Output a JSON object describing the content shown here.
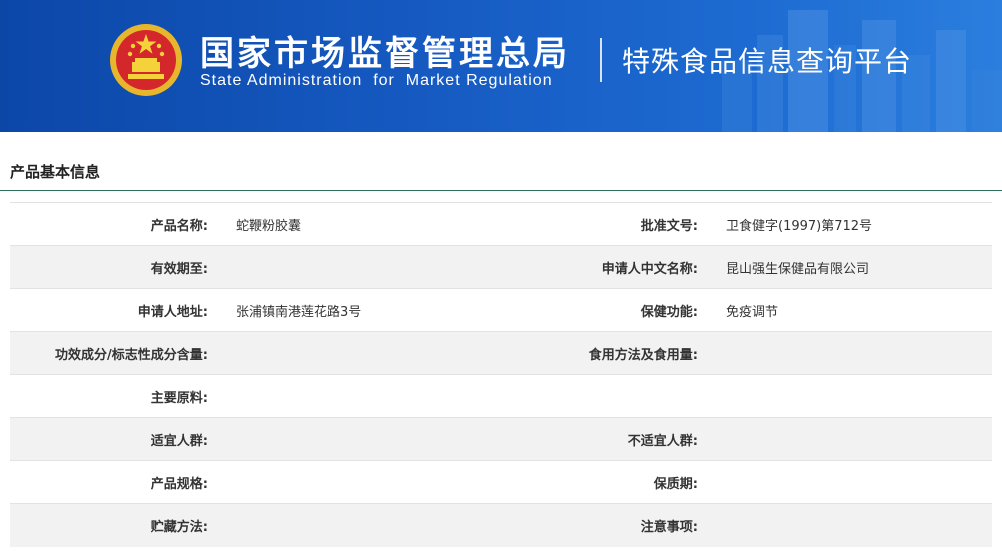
{
  "header": {
    "org_cn": "国家市场监督管理总局",
    "org_en": "State Administration  for  Market Regulation",
    "platform": "特殊食品信息查询平台",
    "brand_color": "#1559c0"
  },
  "panel": {
    "title": "产品基本信息"
  },
  "rows": [
    {
      "label1": "产品名称:",
      "value1": "蛇鞭粉胶囊",
      "label2": "批准文号:",
      "value2": "卫食健字(1997)第712号"
    },
    {
      "label1": "有效期至:",
      "value1": "",
      "label2": "申请人中文名称:",
      "value2": "昆山强生保健品有限公司"
    },
    {
      "label1": "申请人地址:",
      "value1": "张浦镇南港莲花路3号",
      "label2": "保健功能:",
      "value2": "免疫调节"
    },
    {
      "label1": "功效成分/标志性成分含量:",
      "value1": "",
      "label2": "食用方法及食用量:",
      "value2": ""
    },
    {
      "label1": "主要原料:",
      "value1": "",
      "label2": "",
      "value2": ""
    },
    {
      "label1": "适宜人群:",
      "value1": "",
      "label2": "不适宜人群:",
      "value2": ""
    },
    {
      "label1": "产品规格:",
      "value1": "",
      "label2": "保质期:",
      "value2": ""
    },
    {
      "label1": "贮藏方法:",
      "value1": "",
      "label2": "注意事项:",
      "value2": ""
    }
  ]
}
